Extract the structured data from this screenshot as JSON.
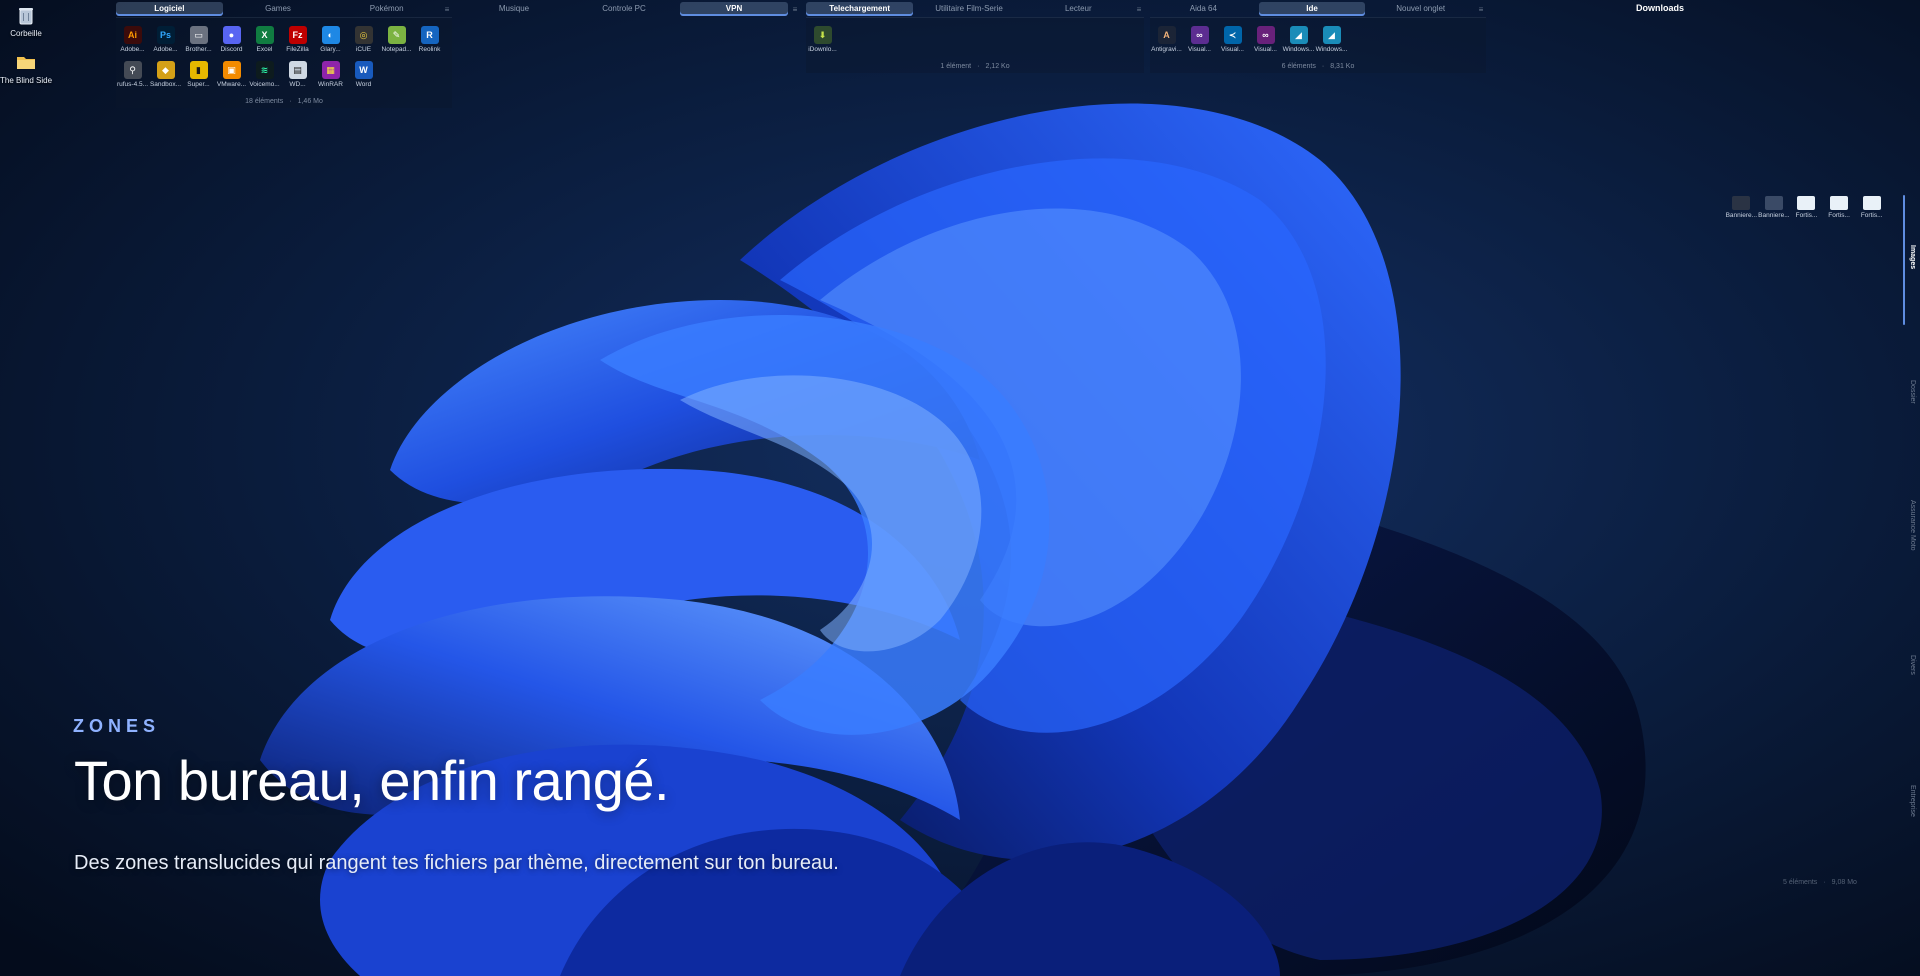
{
  "desktop": {
    "icons": [
      {
        "label": "Corbeille",
        "icon": "recycle-bin-icon"
      },
      {
        "label": "The Blind Side",
        "icon": "folder-icon"
      }
    ]
  },
  "zone1": {
    "tabs": [
      "Logiciel",
      "Games",
      "Pokémon"
    ],
    "active_tab": "Logiciel",
    "items": [
      {
        "label": "Adobe...",
        "icon": "adobe-illustrator-icon",
        "glyph": "Ai",
        "color": "#3b0b0b",
        "fg": "#ff9a00"
      },
      {
        "label": "Adobe...",
        "icon": "adobe-photoshop-icon",
        "glyph": "Ps",
        "color": "#001e36",
        "fg": "#31a8ff"
      },
      {
        "label": "Brother...",
        "icon": "printer-icon",
        "glyph": "▭",
        "color": "#6b7280",
        "fg": "#ffffff"
      },
      {
        "label": "Discord",
        "icon": "discord-icon",
        "glyph": "●",
        "color": "#5865f2",
        "fg": "#ffffff"
      },
      {
        "label": "Excel",
        "icon": "excel-icon",
        "glyph": "X",
        "color": "#107c41",
        "fg": "#ffffff"
      },
      {
        "label": "FileZilla",
        "icon": "filezilla-icon",
        "glyph": "Fz",
        "color": "#bf0000",
        "fg": "#ffffff"
      },
      {
        "label": "Glary...",
        "icon": "glary-icon",
        "glyph": "◐",
        "color": "#1e88e5",
        "fg": "#ffffff"
      },
      {
        "label": "iCUE",
        "icon": "icue-icon",
        "glyph": "◎",
        "color": "#333333",
        "fg": "#f5d442"
      },
      {
        "label": "Notepad...",
        "icon": "notepad-icon",
        "glyph": "✎",
        "color": "#7cb342",
        "fg": "#ffffff"
      },
      {
        "label": "Reolink",
        "icon": "reolink-icon",
        "glyph": "R",
        "color": "#1565c0",
        "fg": "#ffffff"
      },
      {
        "label": "rufus-4.5...",
        "icon": "usb-icon",
        "glyph": "⚲",
        "color": "#444a55",
        "fg": "#ffffff"
      },
      {
        "label": "Sandbox...",
        "icon": "sandbox-icon",
        "glyph": "◆",
        "color": "#d4a017",
        "fg": "#ffffff"
      },
      {
        "label": "Super...",
        "icon": "super-icon",
        "glyph": "▮",
        "color": "#e6b800",
        "fg": "#1a1a1a"
      },
      {
        "label": "VMware...",
        "icon": "vmware-icon",
        "glyph": "▣",
        "color": "#f38b00",
        "fg": "#ffffff"
      },
      {
        "label": "Voicemo...",
        "icon": "voicemod-icon",
        "glyph": "≋",
        "color": "#0d1b1e",
        "fg": "#2cf5a8"
      },
      {
        "label": "WD...",
        "icon": "wd-icon",
        "glyph": "▤",
        "color": "#cfd8e3",
        "fg": "#1a1a1a"
      },
      {
        "label": "WinRAR",
        "icon": "winrar-icon",
        "glyph": "▦",
        "color": "#8e24aa",
        "fg": "#ffeb3b"
      },
      {
        "label": "Word",
        "icon": "word-icon",
        "glyph": "W",
        "color": "#185abd",
        "fg": "#ffffff"
      }
    ],
    "footer_count": "18 éléments",
    "footer_size": "1,46 Mo"
  },
  "zone2": {
    "tabs": [
      "Musique",
      "Controle PC",
      "VPN"
    ],
    "active_tab": "VPN"
  },
  "zone3": {
    "tabs": [
      "Telechargement",
      "Utilitaire Film-Serie",
      "Lecteur"
    ],
    "active_tab": "Telechargement",
    "items": [
      {
        "label": "iDownlo...",
        "icon": "idownloader-icon",
        "glyph": "⬇",
        "color": "#2e4a2e",
        "fg": "#c6e34a"
      }
    ],
    "footer_count": "1 élément",
    "footer_size": "2,12 Ko"
  },
  "zone4": {
    "tabs": [
      "Aida 64",
      "Ide",
      "Nouvel onglet"
    ],
    "active_tab": "Ide",
    "items": [
      {
        "label": "Antigravi...",
        "icon": "antigravity-icon",
        "glyph": "A",
        "color": "#1b2436",
        "fg": "#f0b27a"
      },
      {
        "label": "Visual...",
        "icon": "visual-studio-icon",
        "glyph": "∞",
        "color": "#5c2d91",
        "fg": "#ffffff"
      },
      {
        "label": "Visual...",
        "icon": "vscode-icon",
        "glyph": "≺",
        "color": "#0065a9",
        "fg": "#ffffff"
      },
      {
        "label": "Visual...",
        "icon": "visual-studio-icon",
        "glyph": "∞",
        "color": "#68217a",
        "fg": "#ffffff"
      },
      {
        "label": "Windows...",
        "icon": "windows-app-icon",
        "glyph": "◢",
        "color": "#1a8cb8",
        "fg": "#ffffff"
      },
      {
        "label": "Windows...",
        "icon": "windows-app-icon",
        "glyph": "◢",
        "color": "#1a8cb8",
        "fg": "#ffffff"
      }
    ],
    "footer_count": "6 éléments",
    "footer_size": "8,31 Ko"
  },
  "downloads": {
    "title": "Downloads"
  },
  "side_zone": {
    "items": [
      {
        "label": "Banniere...",
        "icon": "image-thumbnail-icon",
        "color": "#2a3344"
      },
      {
        "label": "Banniere...",
        "icon": "image-thumbnail-icon",
        "color": "#3a4a66"
      },
      {
        "label": "Fortis...",
        "icon": "image-thumbnail-icon",
        "color": "#e9f1f8"
      },
      {
        "label": "Fortis...",
        "icon": "image-thumbnail-icon",
        "color": "#e9f1f8"
      },
      {
        "label": "Fortis...",
        "icon": "image-thumbnail-icon",
        "color": "#e9f1f8"
      }
    ],
    "vertical_tabs": [
      "Images",
      "Dossier",
      "Assurance Moto",
      "Divers",
      "Entreprise"
    ],
    "active_tab": "Images",
    "footer_count": "5 éléments",
    "footer_size": "9,08 Mo"
  },
  "hero": {
    "tag": "ZONES",
    "title": "Ton bureau, enfin rangé.",
    "subtitle": "Des zones translucides qui rangent tes fichiers par thème, directement sur ton bureau."
  },
  "colors": {
    "accent": "#5f8de0",
    "tag": "#8fb2ff",
    "background": "#061226"
  }
}
